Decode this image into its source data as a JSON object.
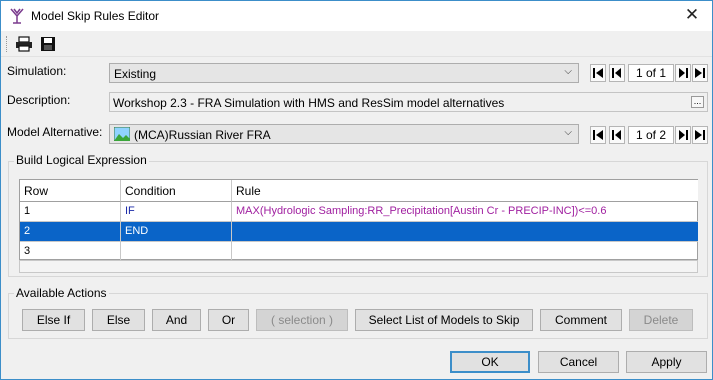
{
  "window": {
    "title": "Model Skip Rules Editor",
    "close_label": "✕"
  },
  "toolbar": {
    "print_icon": "printer-icon",
    "save_icon": "floppy-disk-icon"
  },
  "simulation": {
    "label": "Simulation:",
    "value": "Existing",
    "nav_count": "1 of 1"
  },
  "description": {
    "label": "Description:",
    "value": "Workshop 2.3 - FRA Simulation with HMS and ResSim model alternatives",
    "ellipsis": "..."
  },
  "model_alternative": {
    "label": "Model Alternative:",
    "value": "(MCA)Russian River FRA",
    "icon": "landscape-icon",
    "nav_count": "1 of 2"
  },
  "build_expression": {
    "title": "Build Logical Expression",
    "columns": [
      "Row",
      "Condition",
      "Rule"
    ],
    "rows": [
      {
        "row": "1",
        "condition": "IF",
        "rule": "MAX(Hydrologic Sampling:RR_Precipitation[Austin Cr - PRECIP-INC])<=0.6",
        "selected": false
      },
      {
        "row": "2",
        "condition": "END",
        "rule": "",
        "selected": true
      },
      {
        "row": "3",
        "condition": "",
        "rule": "",
        "selected": false
      }
    ]
  },
  "actions": {
    "title": "Available Actions",
    "else_if": "Else If",
    "else": "Else",
    "and": "And",
    "or": "Or",
    "selection": "( selection )",
    "select_models": "Select List of Models to Skip",
    "comment": "Comment",
    "delete": "Delete"
  },
  "footer": {
    "ok": "OK",
    "cancel": "Cancel",
    "apply": "Apply"
  },
  "colors": {
    "selection": "#0a64c8",
    "condition_text": "#1b2aa8",
    "rule_text": "#a020a0",
    "window_border": "#3c8ec9"
  }
}
